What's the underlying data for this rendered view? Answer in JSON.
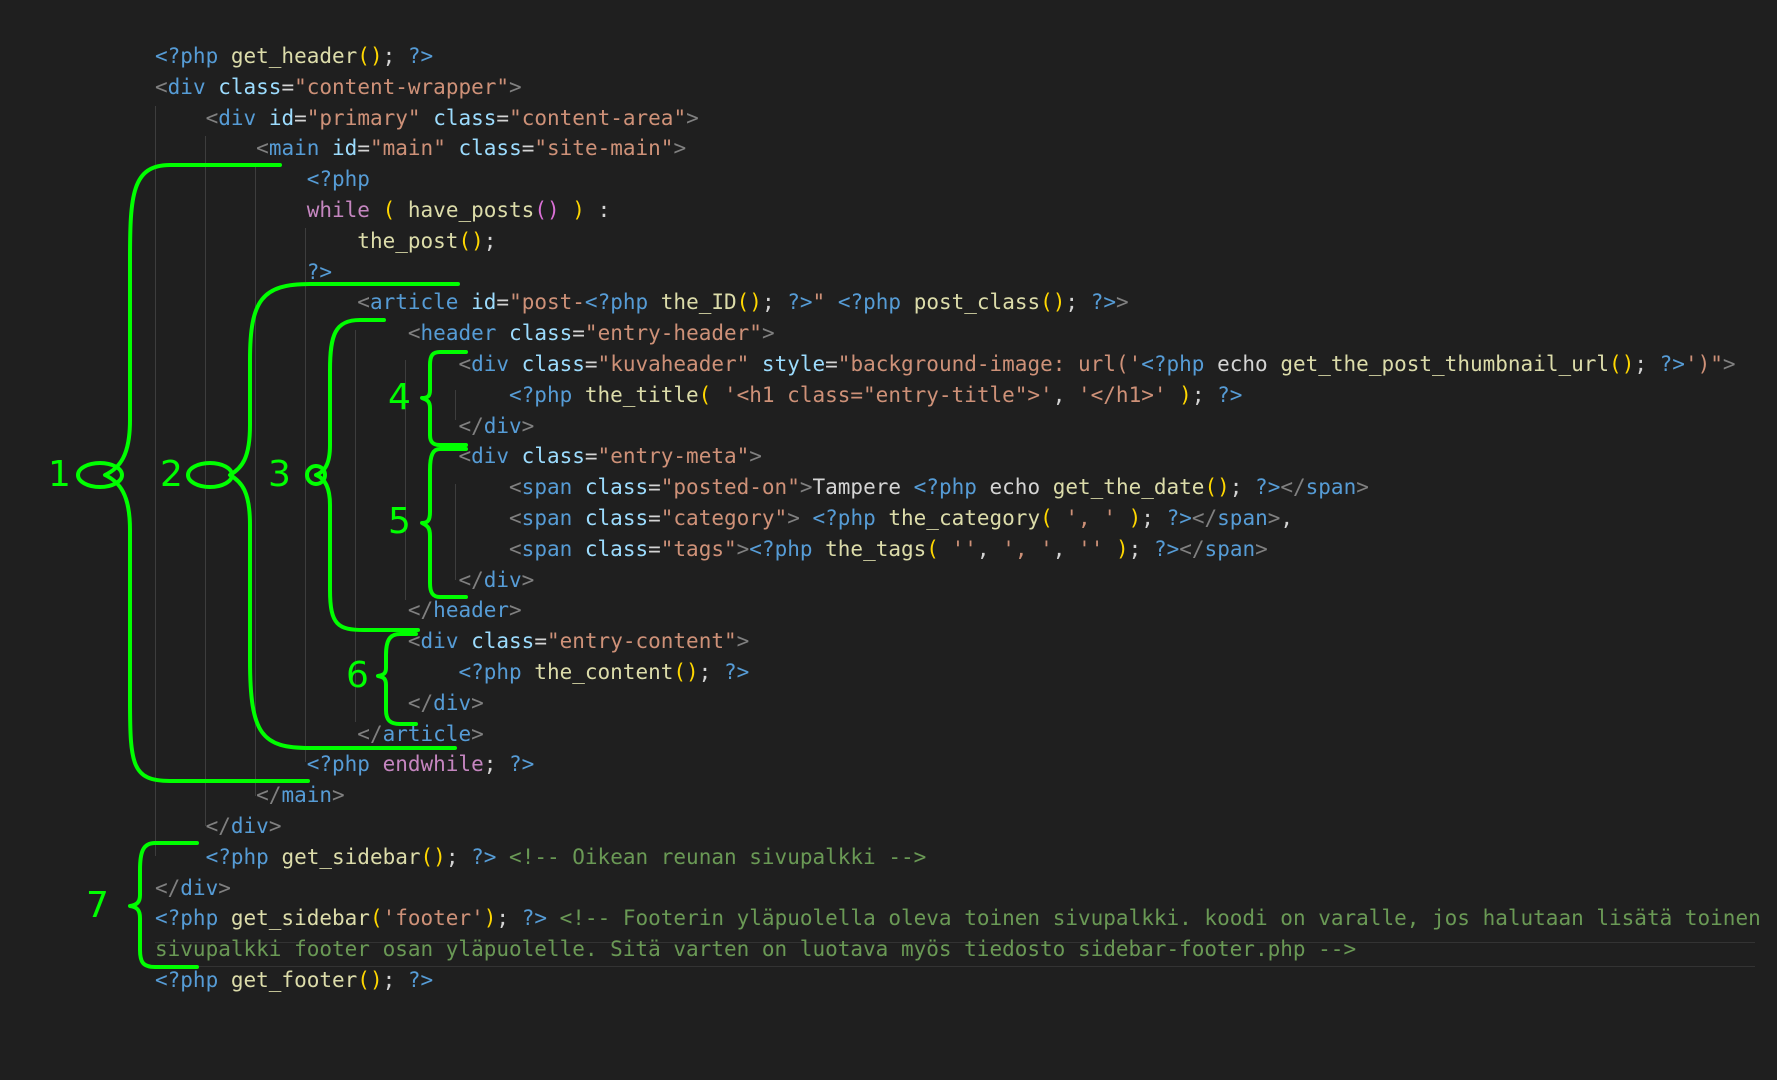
{
  "editor": {
    "lines": [
      [
        [
          "tok-php",
          "<?php "
        ],
        [
          "tok-fn",
          "get_header"
        ],
        [
          "tok-paren",
          "()"
        ],
        [
          "tok-text",
          "; "
        ],
        [
          "tok-php",
          "?>"
        ]
      ],
      [
        [
          "tok-punc",
          "<"
        ],
        [
          "tok-tag",
          "div "
        ],
        [
          "tok-attr",
          "class"
        ],
        [
          "tok-text",
          "="
        ],
        [
          "tok-str",
          "\"content-wrapper\""
        ],
        [
          "tok-punc",
          ">"
        ]
      ],
      [
        [
          "tok-text",
          "    "
        ],
        [
          "tok-punc",
          "<"
        ],
        [
          "tok-tag",
          "div "
        ],
        [
          "tok-attr",
          "id"
        ],
        [
          "tok-text",
          "="
        ],
        [
          "tok-str",
          "\"primary\" "
        ],
        [
          "tok-attr",
          "class"
        ],
        [
          "tok-text",
          "="
        ],
        [
          "tok-str",
          "\"content-area\""
        ],
        [
          "tok-punc",
          ">"
        ]
      ],
      [
        [
          "tok-text",
          "        "
        ],
        [
          "tok-punc",
          "<"
        ],
        [
          "tok-tag",
          "main "
        ],
        [
          "tok-attr",
          "id"
        ],
        [
          "tok-text",
          "="
        ],
        [
          "tok-str",
          "\"main\" "
        ],
        [
          "tok-attr",
          "class"
        ],
        [
          "tok-text",
          "="
        ],
        [
          "tok-str",
          "\"site-main\""
        ],
        [
          "tok-punc",
          ">"
        ]
      ],
      [
        [
          "tok-text",
          "            "
        ],
        [
          "tok-php",
          "<?php"
        ]
      ],
      [
        [
          "tok-text",
          "            "
        ],
        [
          "tok-kw",
          "while"
        ],
        [
          "tok-text",
          " "
        ],
        [
          "tok-paren",
          "( "
        ],
        [
          "tok-fn",
          "have_posts"
        ],
        [
          "tok-paren2",
          "()"
        ],
        [
          "tok-paren",
          " )"
        ],
        [
          "tok-text",
          " :"
        ]
      ],
      [
        [
          "tok-text",
          "                "
        ],
        [
          "tok-fn",
          "the_post"
        ],
        [
          "tok-paren",
          "()"
        ],
        [
          "tok-text",
          ";"
        ]
      ],
      [
        [
          "tok-text",
          "            "
        ],
        [
          "tok-php",
          "?>"
        ]
      ],
      [
        [
          "tok-text",
          "                "
        ],
        [
          "tok-punc",
          "<"
        ],
        [
          "tok-tag",
          "article "
        ],
        [
          "tok-attr",
          "id"
        ],
        [
          "tok-text",
          "="
        ],
        [
          "tok-str",
          "\"post-"
        ],
        [
          "tok-php",
          "<?php "
        ],
        [
          "tok-fn",
          "the_ID"
        ],
        [
          "tok-paren",
          "()"
        ],
        [
          "tok-text",
          "; "
        ],
        [
          "tok-php",
          "?>"
        ],
        [
          "tok-str",
          "\" "
        ],
        [
          "tok-php",
          "<?php "
        ],
        [
          "tok-fn",
          "post_class"
        ],
        [
          "tok-paren",
          "()"
        ],
        [
          "tok-text",
          "; "
        ],
        [
          "tok-php",
          "?>"
        ],
        [
          "tok-punc",
          ">"
        ]
      ],
      [
        [
          "tok-text",
          "                    "
        ],
        [
          "tok-punc",
          "<"
        ],
        [
          "tok-tag",
          "header "
        ],
        [
          "tok-attr",
          "class"
        ],
        [
          "tok-text",
          "="
        ],
        [
          "tok-str",
          "\"entry-header\""
        ],
        [
          "tok-punc",
          ">"
        ]
      ],
      [
        [
          "tok-text",
          "                        "
        ],
        [
          "tok-punc",
          "<"
        ],
        [
          "tok-tag",
          "div "
        ],
        [
          "tok-attr",
          "class"
        ],
        [
          "tok-text",
          "="
        ],
        [
          "tok-str",
          "\"kuvaheader\" "
        ],
        [
          "tok-attr",
          "style"
        ],
        [
          "tok-text",
          "="
        ],
        [
          "tok-str",
          "\"background-image: url('"
        ],
        [
          "tok-php",
          "<?php "
        ],
        [
          "tok-text",
          "echo "
        ],
        [
          "tok-fn",
          "get_the_post_thumbnail_url"
        ],
        [
          "tok-paren",
          "()"
        ],
        [
          "tok-text",
          "; "
        ],
        [
          "tok-php",
          "?>"
        ],
        [
          "tok-str",
          "')\""
        ],
        [
          "tok-punc",
          ">"
        ]
      ],
      [
        [
          "tok-text",
          "                            "
        ],
        [
          "tok-php",
          "<?php "
        ],
        [
          "tok-fn",
          "the_title"
        ],
        [
          "tok-paren",
          "( "
        ],
        [
          "tok-str",
          "'<h1 class=\"entry-title\">'"
        ],
        [
          "tok-text",
          ", "
        ],
        [
          "tok-str",
          "'</h1>'"
        ],
        [
          "tok-paren",
          " )"
        ],
        [
          "tok-text",
          "; "
        ],
        [
          "tok-php",
          "?>"
        ]
      ],
      [
        [
          "tok-text",
          "                        "
        ],
        [
          "tok-punc",
          "</"
        ],
        [
          "tok-tag",
          "div"
        ],
        [
          "tok-punc",
          ">"
        ]
      ],
      [
        [
          "tok-text",
          "                        "
        ],
        [
          "tok-punc",
          "<"
        ],
        [
          "tok-tag",
          "div "
        ],
        [
          "tok-attr",
          "class"
        ],
        [
          "tok-text",
          "="
        ],
        [
          "tok-str",
          "\"entry-meta\""
        ],
        [
          "tok-punc",
          ">"
        ]
      ],
      [
        [
          "tok-text",
          "                            "
        ],
        [
          "tok-punc",
          "<"
        ],
        [
          "tok-tag",
          "span "
        ],
        [
          "tok-attr",
          "class"
        ],
        [
          "tok-text",
          "="
        ],
        [
          "tok-str",
          "\"posted-on\""
        ],
        [
          "tok-punc",
          ">"
        ],
        [
          "tok-text",
          "Tampere "
        ],
        [
          "tok-php",
          "<?php "
        ],
        [
          "tok-text",
          "echo "
        ],
        [
          "tok-fn",
          "get_the_date"
        ],
        [
          "tok-paren",
          "()"
        ],
        [
          "tok-text",
          "; "
        ],
        [
          "tok-php",
          "?>"
        ],
        [
          "tok-punc",
          "</"
        ],
        [
          "tok-tag",
          "span"
        ],
        [
          "tok-punc",
          ">"
        ]
      ],
      [
        [
          "tok-text",
          "                            "
        ],
        [
          "tok-punc",
          "<"
        ],
        [
          "tok-tag",
          "span "
        ],
        [
          "tok-attr",
          "class"
        ],
        [
          "tok-text",
          "="
        ],
        [
          "tok-str",
          "\"category\""
        ],
        [
          "tok-punc",
          ">"
        ],
        [
          "tok-text",
          " "
        ],
        [
          "tok-php",
          "<?php "
        ],
        [
          "tok-fn",
          "the_category"
        ],
        [
          "tok-paren",
          "( "
        ],
        [
          "tok-str",
          "', '"
        ],
        [
          "tok-paren",
          " )"
        ],
        [
          "tok-text",
          "; "
        ],
        [
          "tok-php",
          "?>"
        ],
        [
          "tok-punc",
          "</"
        ],
        [
          "tok-tag",
          "span"
        ],
        [
          "tok-punc",
          ">"
        ],
        [
          "tok-text",
          ","
        ]
      ],
      [
        [
          "tok-text",
          "                            "
        ],
        [
          "tok-punc",
          "<"
        ],
        [
          "tok-tag",
          "span "
        ],
        [
          "tok-attr",
          "class"
        ],
        [
          "tok-text",
          "="
        ],
        [
          "tok-str",
          "\"tags\""
        ],
        [
          "tok-punc",
          ">"
        ],
        [
          "tok-php",
          "<?php "
        ],
        [
          "tok-fn",
          "the_tags"
        ],
        [
          "tok-paren",
          "( "
        ],
        [
          "tok-str",
          "''"
        ],
        [
          "tok-text",
          ", "
        ],
        [
          "tok-str",
          "', '"
        ],
        [
          "tok-text",
          ", "
        ],
        [
          "tok-str",
          "''"
        ],
        [
          "tok-paren",
          " )"
        ],
        [
          "tok-text",
          "; "
        ],
        [
          "tok-php",
          "?>"
        ],
        [
          "tok-punc",
          "</"
        ],
        [
          "tok-tag",
          "span"
        ],
        [
          "tok-punc",
          ">"
        ]
      ],
      [
        [
          "tok-text",
          "                        "
        ],
        [
          "tok-punc",
          "</"
        ],
        [
          "tok-tag",
          "div"
        ],
        [
          "tok-punc",
          ">"
        ]
      ],
      [
        [
          "tok-text",
          "                    "
        ],
        [
          "tok-punc",
          "</"
        ],
        [
          "tok-tag",
          "header"
        ],
        [
          "tok-punc",
          ">"
        ]
      ],
      [
        [
          "tok-text",
          "                    "
        ],
        [
          "tok-punc",
          "<"
        ],
        [
          "tok-tag",
          "div "
        ],
        [
          "tok-attr",
          "class"
        ],
        [
          "tok-text",
          "="
        ],
        [
          "tok-str",
          "\"entry-content\""
        ],
        [
          "tok-punc",
          ">"
        ]
      ],
      [
        [
          "tok-text",
          "                        "
        ],
        [
          "tok-php",
          "<?php "
        ],
        [
          "tok-fn",
          "the_content"
        ],
        [
          "tok-paren",
          "()"
        ],
        [
          "tok-text",
          "; "
        ],
        [
          "tok-php",
          "?>"
        ]
      ],
      [
        [
          "tok-text",
          "                    "
        ],
        [
          "tok-punc",
          "</"
        ],
        [
          "tok-tag",
          "div"
        ],
        [
          "tok-punc",
          ">"
        ]
      ],
      [
        [
          "tok-text",
          "                "
        ],
        [
          "tok-punc",
          "</"
        ],
        [
          "tok-tag",
          "article"
        ],
        [
          "tok-punc",
          ">"
        ]
      ],
      [
        [
          "tok-text",
          "            "
        ],
        [
          "tok-php",
          "<?php "
        ],
        [
          "tok-kw",
          "endwhile"
        ],
        [
          "tok-text",
          "; "
        ],
        [
          "tok-php",
          "?>"
        ]
      ],
      [
        [
          "tok-text",
          "        "
        ],
        [
          "tok-punc",
          "</"
        ],
        [
          "tok-tag",
          "main"
        ],
        [
          "tok-punc",
          ">"
        ]
      ],
      [
        [
          "tok-text",
          "    "
        ],
        [
          "tok-punc",
          "</"
        ],
        [
          "tok-tag",
          "div"
        ],
        [
          "tok-punc",
          ">"
        ]
      ],
      [
        [
          "tok-text",
          "    "
        ],
        [
          "tok-php",
          "<?php "
        ],
        [
          "tok-fn",
          "get_sidebar"
        ],
        [
          "tok-paren",
          "()"
        ],
        [
          "tok-text",
          "; "
        ],
        [
          "tok-php",
          "?> "
        ],
        [
          "tok-cmt",
          "<!-- Oikean reunan sivupalkki -->"
        ]
      ],
      [
        [
          "tok-punc",
          "</"
        ],
        [
          "tok-tag",
          "div"
        ],
        [
          "tok-punc",
          ">"
        ]
      ],
      [
        [
          "tok-php",
          "<?php "
        ],
        [
          "tok-fn",
          "get_sidebar"
        ],
        [
          "tok-paren",
          "("
        ],
        [
          "tok-str",
          "'footer'"
        ],
        [
          "tok-paren",
          ")"
        ],
        [
          "tok-text",
          "; "
        ],
        [
          "tok-php",
          "?> "
        ],
        [
          "tok-cmt",
          "<!-- Footerin yläpuolella oleva toinen sivupalkki. koodi on varalle, jos halutaan lisätä toinen"
        ]
      ],
      [
        [
          "tok-cmt",
          "sivupalkki footer osan yläpuolelle. Sitä varten on luotava myös tiedosto sidebar-footer.php -->"
        ]
      ],
      [
        [
          "tok-php",
          "<?php "
        ],
        [
          "tok-fn",
          "get_footer"
        ],
        [
          "tok-paren",
          "()"
        ],
        [
          "tok-text",
          "; "
        ],
        [
          "tok-php",
          "?>"
        ]
      ]
    ]
  },
  "annotations": {
    "color": "#00ff00",
    "labels": [
      "1",
      "2",
      "3",
      "4",
      "5",
      "6",
      "7"
    ]
  }
}
